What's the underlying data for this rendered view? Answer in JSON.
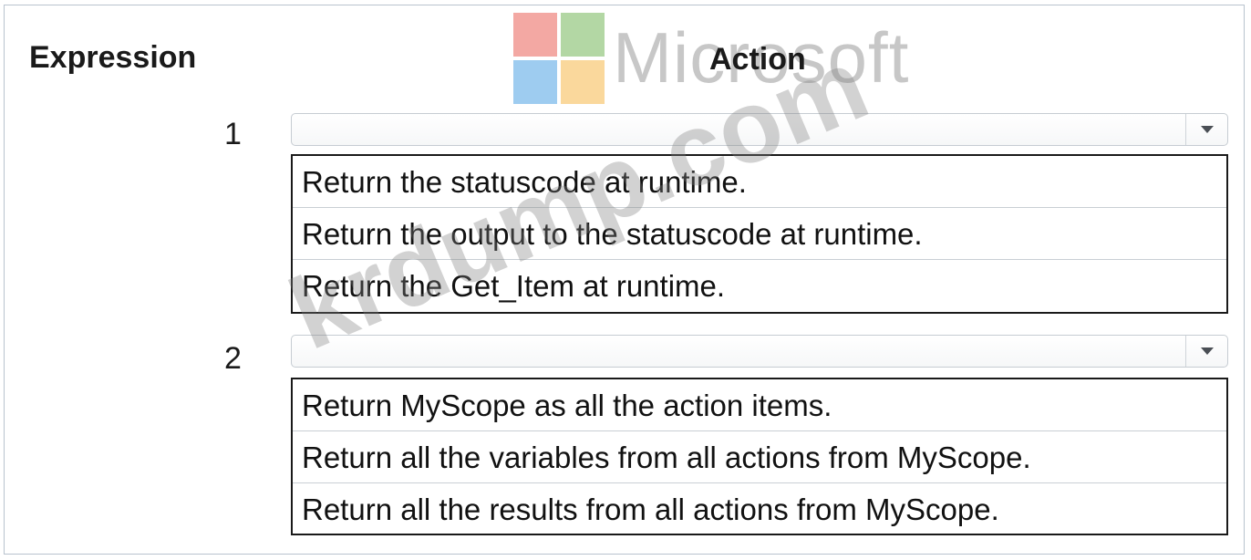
{
  "watermark": {
    "brand_word": "Microsoft",
    "site_text": "krdump.com",
    "logo_colors": [
      "#e8534a",
      "#6ab04c",
      "#3f9ae3",
      "#f7b23b"
    ]
  },
  "headers": {
    "expression": "Expression",
    "action": "Action"
  },
  "rows": [
    {
      "number": "1",
      "selected_value": "",
      "options": [
        "Return the statuscode at runtime.",
        "Return the output to the statuscode at runtime.",
        "Return the Get_Item at runtime."
      ]
    },
    {
      "number": "2",
      "selected_value": "",
      "options": [
        "Return MyScope as all the action items.",
        "Return all the variables from all actions from MyScope.",
        "Return all the results from all actions from MyScope."
      ]
    }
  ],
  "icons": {
    "dropdown": "chevron-down-icon"
  }
}
